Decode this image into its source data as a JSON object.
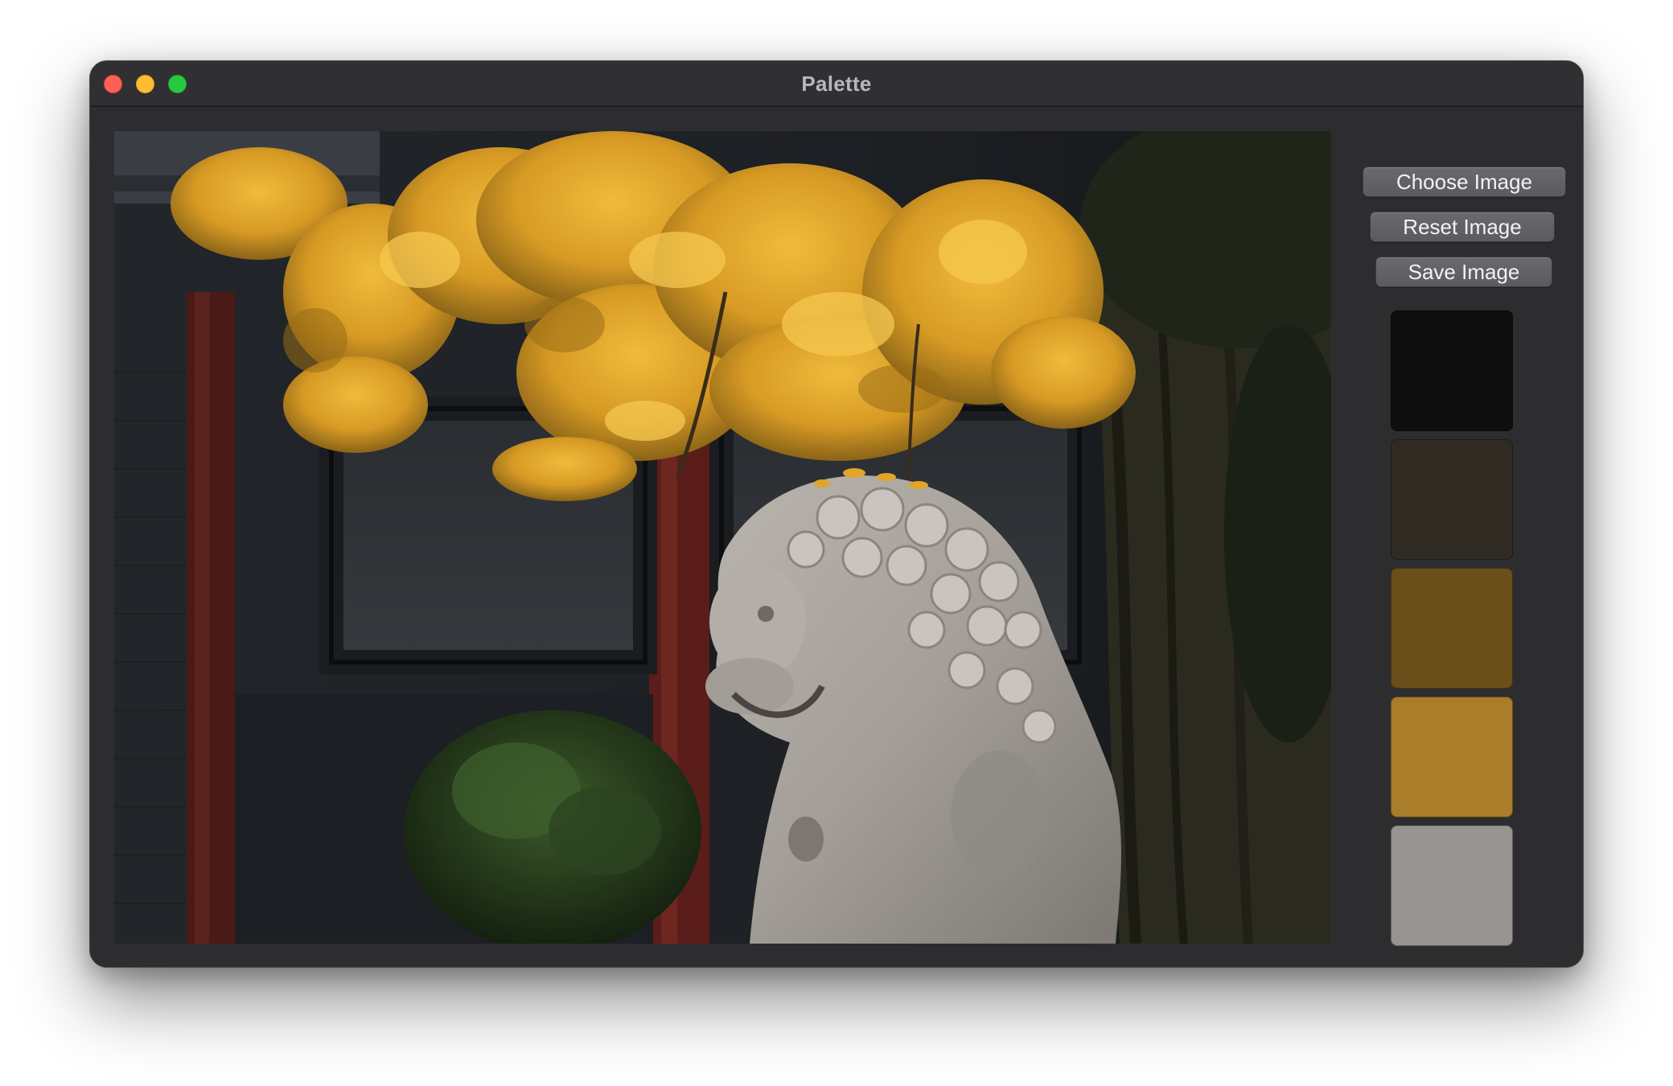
{
  "window": {
    "title": "Palette"
  },
  "traffic_lights": {
    "close": "#ff5f57",
    "minimize": "#febc2e",
    "maximize": "#28c840"
  },
  "toolbar": {
    "choose_label": "Choose Image",
    "reset_label": "Reset Image",
    "save_label": "Save Image"
  },
  "image": {
    "subject": "stone guardian lion under yellow ginkgo tree"
  },
  "palette": {
    "swatches": [
      {
        "color": "#0e0e0e"
      },
      {
        "color": "#2f2b22"
      },
      {
        "color": "#6b4f1a"
      },
      {
        "color": "#a97d29"
      },
      {
        "color": "#979390"
      }
    ]
  }
}
